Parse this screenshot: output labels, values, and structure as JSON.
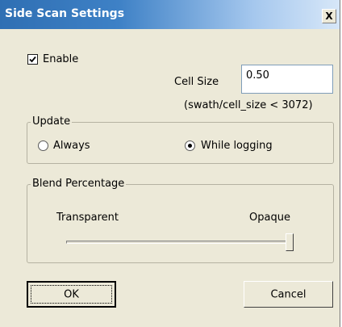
{
  "window": {
    "title": "Side Scan Settings",
    "close_symbol": "X"
  },
  "enable": {
    "label": "Enable",
    "checked": true
  },
  "cell_size": {
    "label": "Cell Size",
    "value": "0.50",
    "hint": "(swath/cell_size  < 3072)"
  },
  "update": {
    "group_label": "Update",
    "options": [
      {
        "label": "Always",
        "selected": false
      },
      {
        "label": "While logging",
        "selected": true
      }
    ]
  },
  "blend": {
    "group_label": "Blend Percentage",
    "min_label": "Transparent",
    "max_label": "Opaque",
    "value_fraction": 1.0
  },
  "buttons": {
    "ok": "OK",
    "cancel": "Cancel"
  }
}
